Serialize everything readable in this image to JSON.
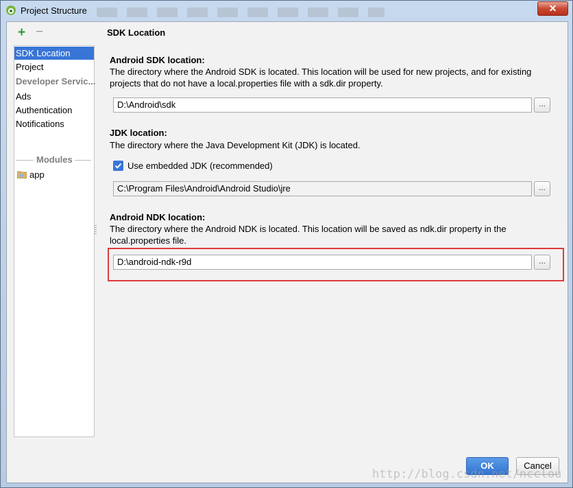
{
  "window": {
    "title": "Project Structure",
    "close_label": "✕"
  },
  "toolbar": {
    "add_label": "+",
    "remove_label": "−"
  },
  "sidebar": {
    "items": [
      {
        "label": "SDK Location",
        "selected": true
      },
      {
        "label": "Project"
      }
    ],
    "developer_section": "Developer Servic...",
    "developer_items": [
      "Ads",
      "Authentication",
      "Notifications"
    ],
    "modules_label": "Modules",
    "modules": [
      "app"
    ]
  },
  "panel": {
    "title": "SDK Location",
    "android_sdk": {
      "title": "Android SDK location:",
      "description": "The directory where the Android SDK is located. This location will be used for new projects, and for existing projects that do not have a local.properties file with a sdk.dir property.",
      "value": "D:\\Android\\sdk"
    },
    "jdk": {
      "title": "JDK location:",
      "description": "The directory where the Java Development Kit (JDK) is located.",
      "checkbox_label": "Use embedded JDK (recommended)",
      "checkbox_checked": true,
      "value": "C:\\Program Files\\Android\\Android Studio\\jre"
    },
    "android_ndk": {
      "title": "Android NDK location:",
      "description": "The directory where the Android NDK is located. This location will be saved as ndk.dir property in the local.properties file.",
      "value": "D:\\android-ndk-r9d"
    },
    "browse_label": "..."
  },
  "buttons": {
    "ok": "OK",
    "cancel": "Cancel"
  },
  "watermark": "http://blog.csdn.net/ncclou",
  "colors": {
    "selection": "#3875d7",
    "highlight_box": "#e03a3a",
    "add_icon": "#2b9a2b"
  }
}
